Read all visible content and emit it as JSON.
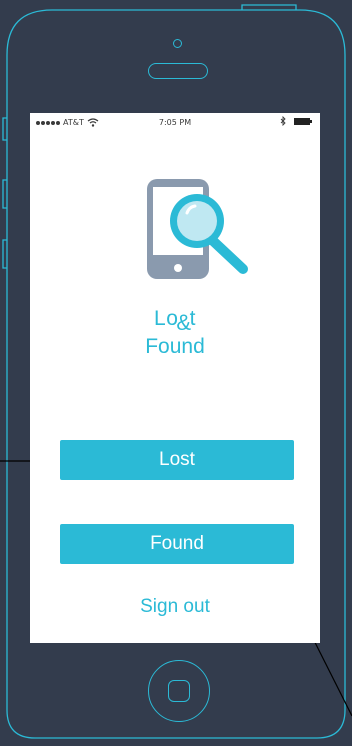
{
  "status_bar": {
    "carrier": "AT&T",
    "time": "7:05 PM"
  },
  "app": {
    "title_part1": "Lo",
    "title_amp": "&",
    "title_part2": "t",
    "title_line2": "Found"
  },
  "buttons": {
    "lost_label": "Lost",
    "found_label": "Found",
    "sign_out_label": "Sign out"
  },
  "colors": {
    "accent": "#2bbad6",
    "background": "#333c4d",
    "icon_gray": "#8a9aae"
  },
  "icons": [
    "signal-dots-icon",
    "wifi-icon",
    "bluetooth-icon",
    "battery-icon",
    "phone-search-icon"
  ]
}
